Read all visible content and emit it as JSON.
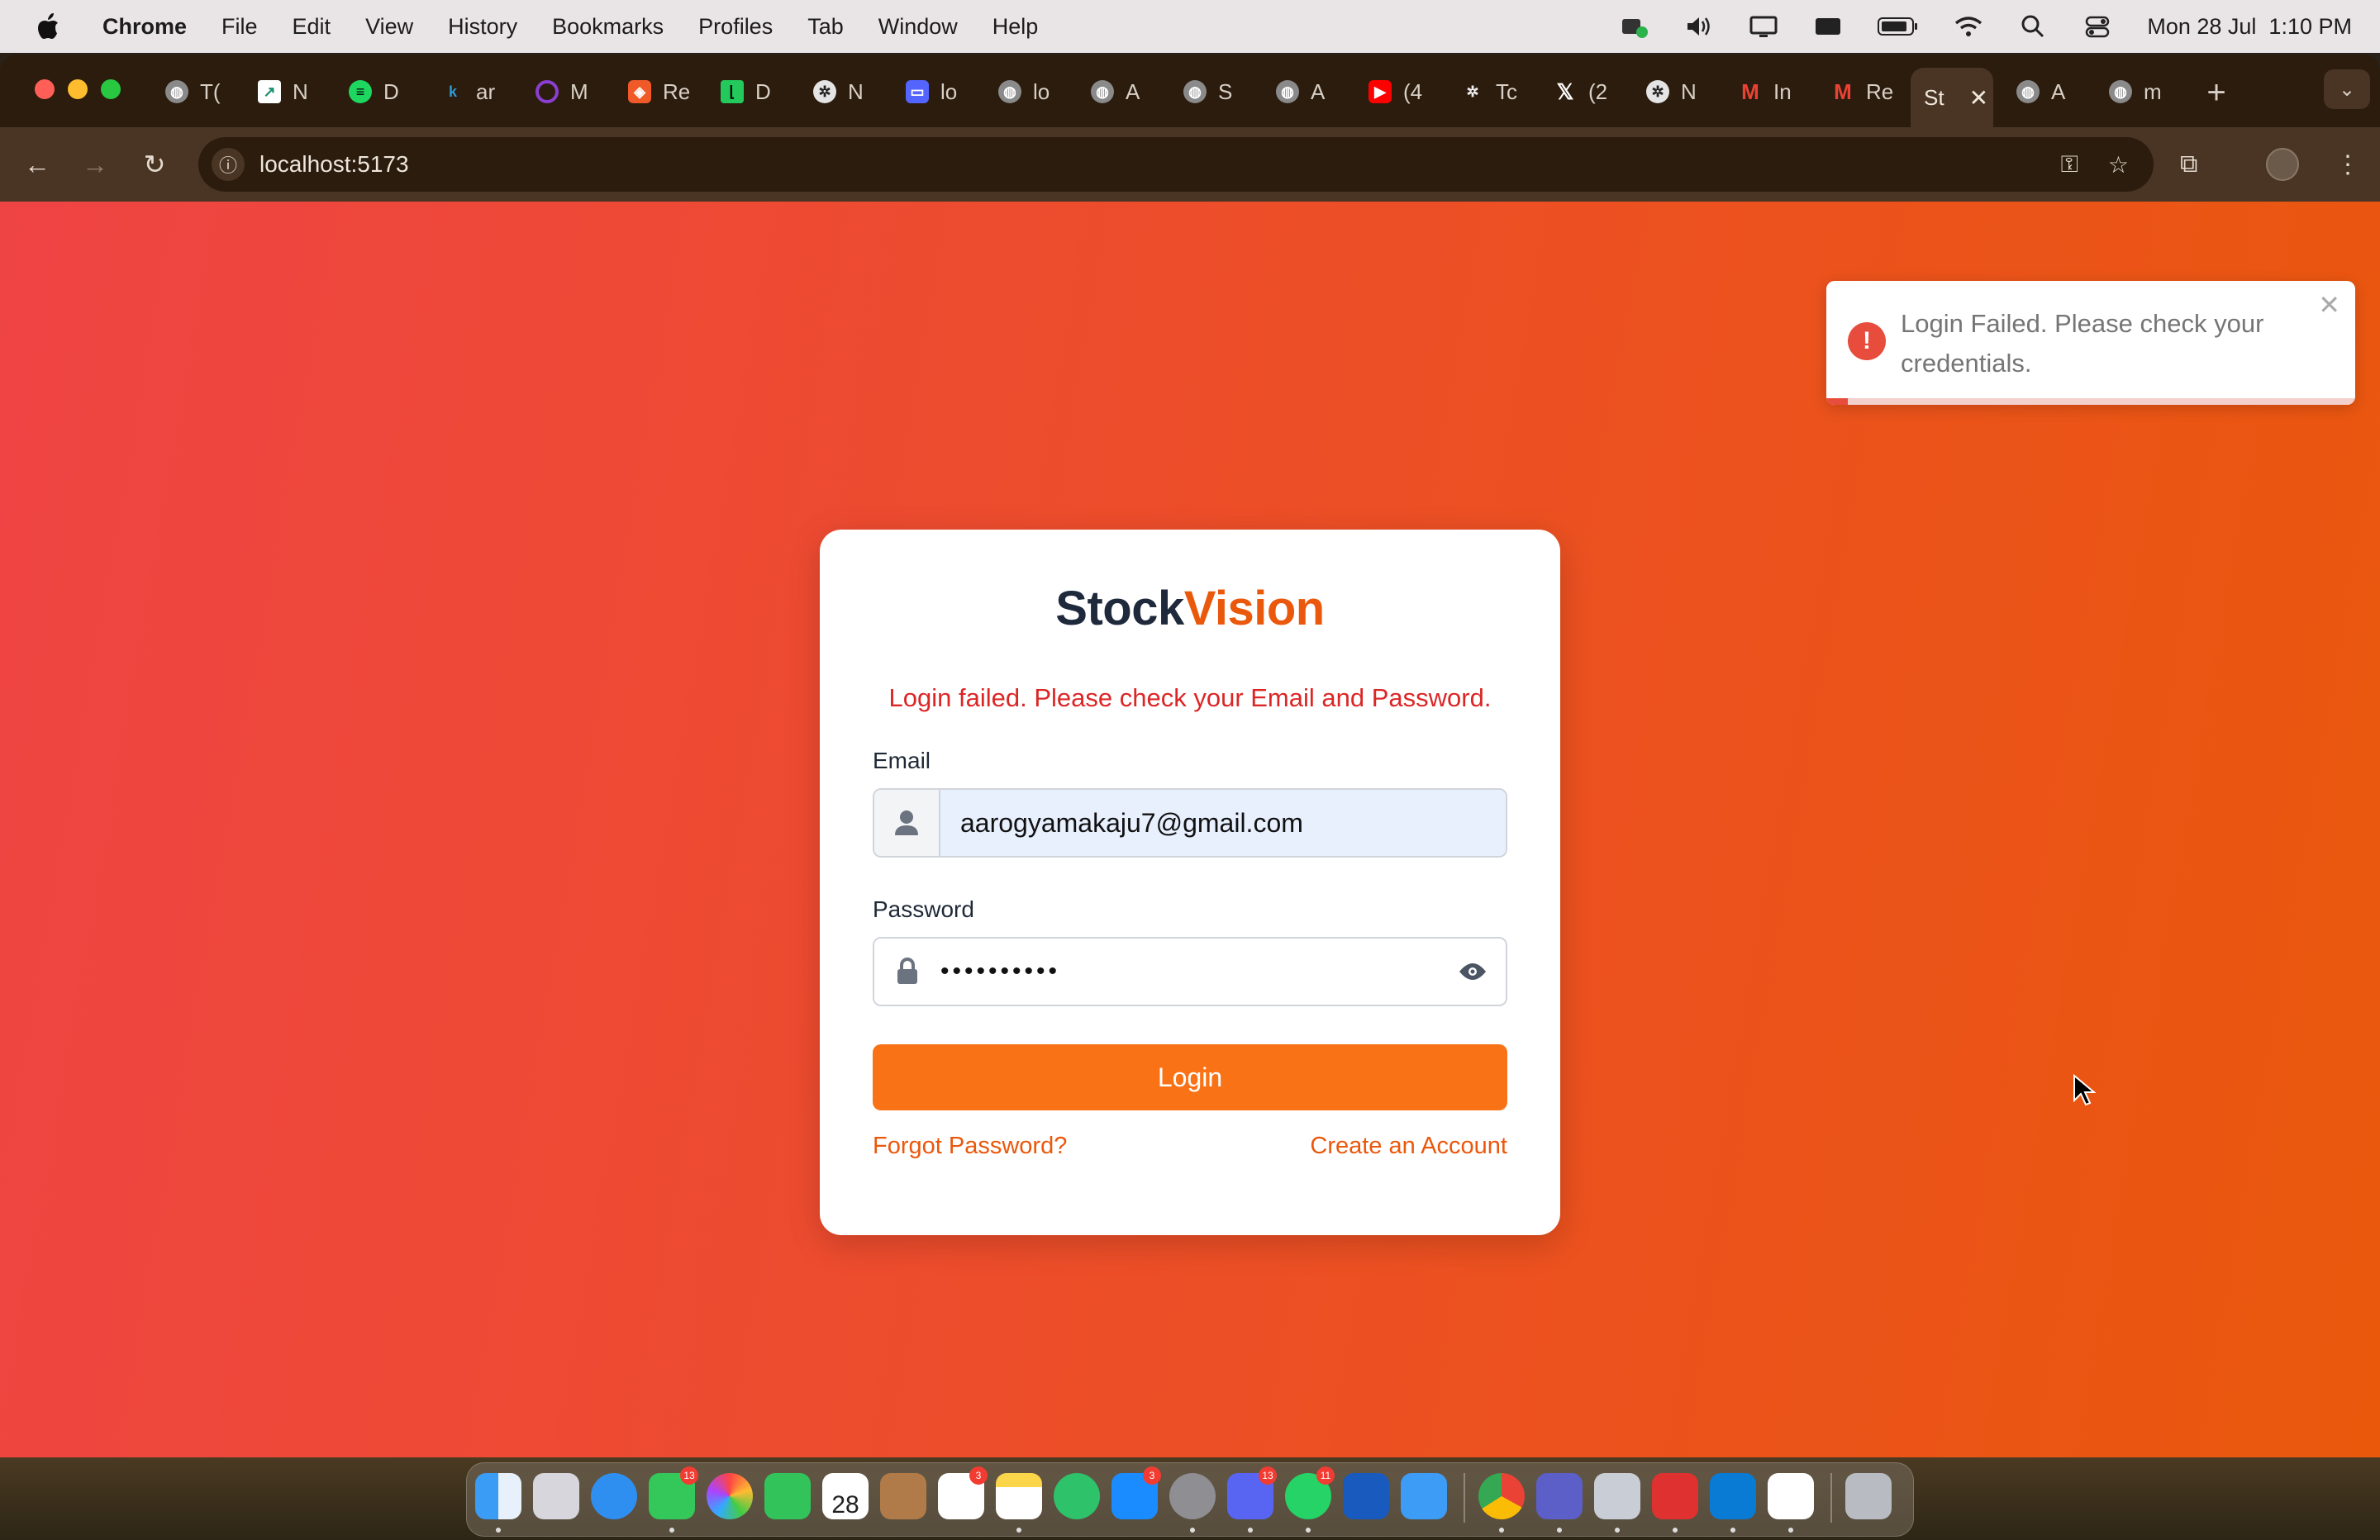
{
  "menubar": {
    "app_name": "Chrome",
    "items": [
      "File",
      "Edit",
      "View",
      "History",
      "Bookmarks",
      "Profiles",
      "Tab",
      "Window",
      "Help"
    ],
    "clock": "Mon 28 Jul  1:10 PM"
  },
  "tabs": [
    {
      "label": "T(",
      "icon": "globe-icon"
    },
    {
      "label": "N",
      "icon": "chart-icon"
    },
    {
      "label": "D",
      "icon": "spotify-icon"
    },
    {
      "label": "ar",
      "icon": "k-icon"
    },
    {
      "label": "M",
      "icon": "circle-icon"
    },
    {
      "label": "Re",
      "icon": "ring-icon"
    },
    {
      "label": "D",
      "icon": "leetcode-icon"
    },
    {
      "label": "N",
      "icon": "chatgpt-icon"
    },
    {
      "label": "lo",
      "icon": "laptop-icon"
    },
    {
      "label": "lo",
      "icon": "globe-icon"
    },
    {
      "label": "A",
      "icon": "globe-icon"
    },
    {
      "label": "S",
      "icon": "globe-icon"
    },
    {
      "label": "A",
      "icon": "globe-icon"
    },
    {
      "label": "(4",
      "icon": "youtube-icon"
    },
    {
      "label": "Tc",
      "icon": "openai-icon"
    },
    {
      "label": "(2",
      "icon": "x-icon"
    },
    {
      "label": "N",
      "icon": "chatgpt-icon"
    },
    {
      "label": "In",
      "icon": "gmail-icon"
    },
    {
      "label": "Re",
      "icon": "gmail-icon"
    },
    {
      "label": "St",
      "icon": "none",
      "active": true
    },
    {
      "label": "A",
      "icon": "globe-icon"
    },
    {
      "label": "m",
      "icon": "globe-icon"
    }
  ],
  "address_bar": {
    "url": "localhost:5173"
  },
  "toast": {
    "message": "Login Failed. Please check your credentials."
  },
  "login": {
    "brand_part1": "Stock",
    "brand_part2": "Vision",
    "error": "Login failed. Please check your Email and Password.",
    "email_label": "Email",
    "email_value": "aarogyamakaju7@gmail.com",
    "password_label": "Password",
    "password_mask": "••••••••••",
    "login_button": "Login",
    "forgot_link": "Forgot Password?",
    "create_link": "Create an Account"
  },
  "dock": {
    "badges": [
      "13",
      "3",
      "3",
      "13",
      "11"
    ],
    "calendar_day": "28"
  },
  "colors": {
    "gradient_start": "#ef4444",
    "gradient_end": "#ea580c",
    "accent": "#f97316",
    "error": "#dc2626"
  }
}
